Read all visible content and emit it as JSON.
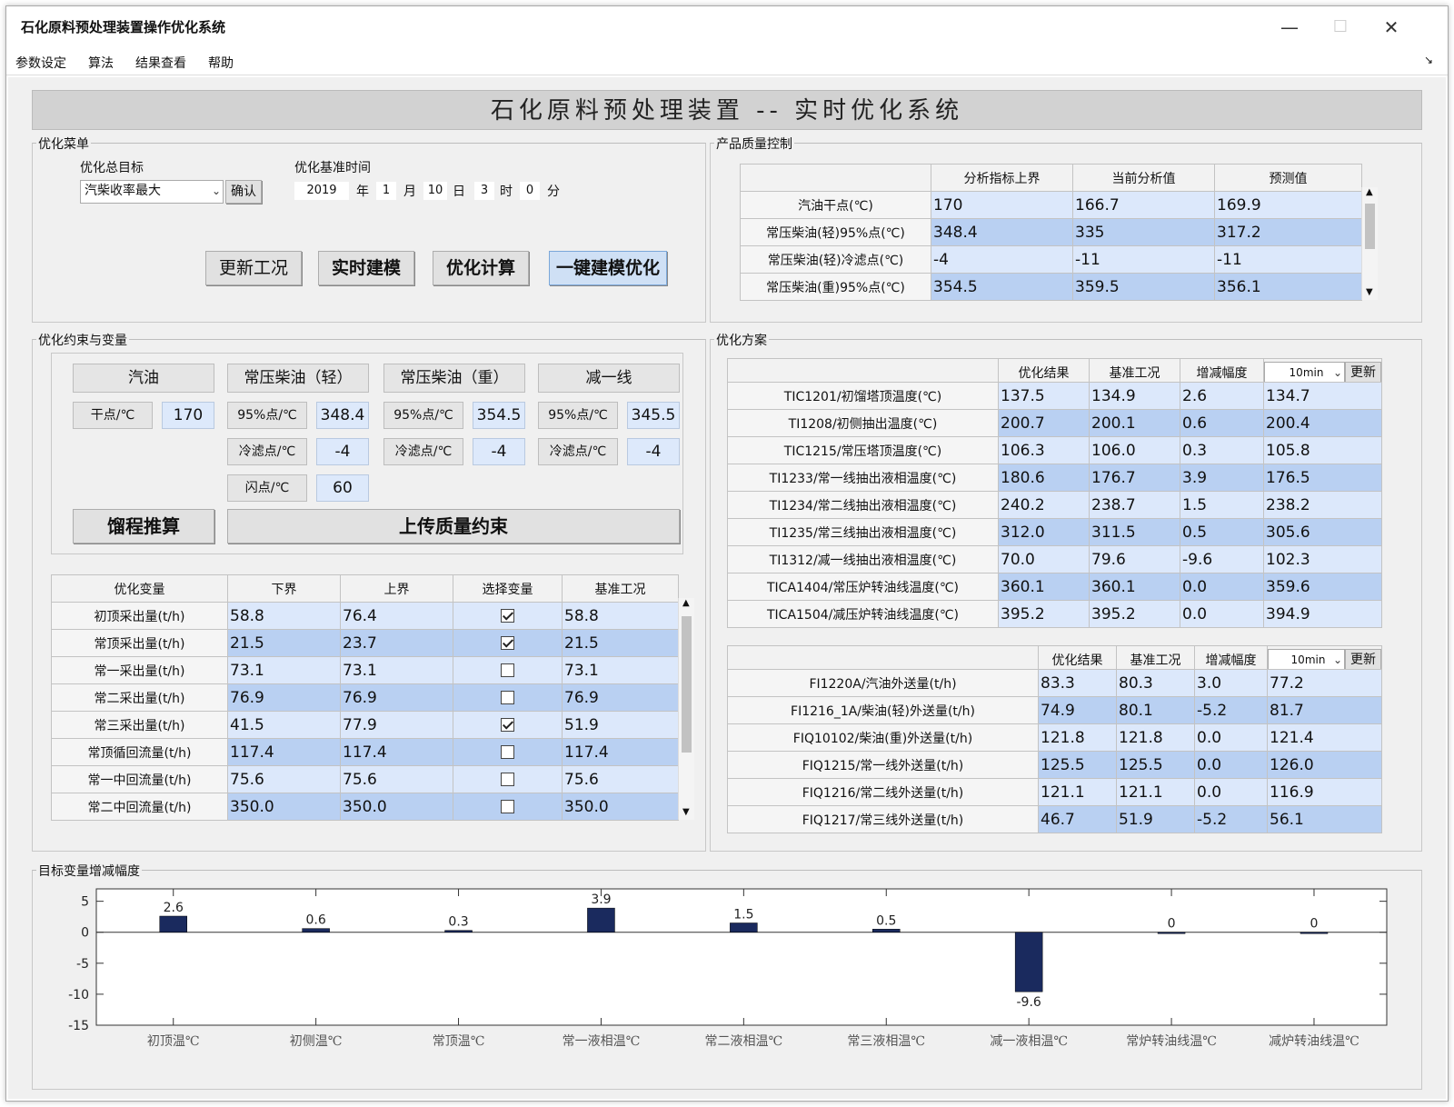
{
  "window": {
    "title": "石化原料预处理装置操作优化系统"
  },
  "menu": [
    "参数设定",
    "算法",
    "结果查看",
    "帮助"
  ],
  "banner": "石化原料预处理装置 -- 实时优化系统",
  "opt_menu": {
    "title": "优化菜单",
    "goal_label": "优化总目标",
    "goal_value": "汽柴收率最大",
    "confirm": "确认",
    "time_label": "优化基准时间",
    "year": "2019",
    "year_u": "年",
    "month": "1",
    "month_u": "月",
    "day": "10",
    "day_u": "日",
    "hour": "3",
    "hour_u": "时",
    "minute": "0",
    "minute_u": "分",
    "buttons": [
      "更新工况",
      "实时建模",
      "优化计算",
      "一键建模优化"
    ]
  },
  "quality": {
    "title": "产品质量控制",
    "headers": [
      "分析指标上界",
      "当前分析值",
      "预测值"
    ],
    "rows": [
      {
        "name": "汽油干点(℃)",
        "v": [
          "170",
          "166.7",
          "169.9"
        ]
      },
      {
        "name": "常压柴油(轻)95%点(℃)",
        "v": [
          "348.4",
          "335",
          "317.2"
        ]
      },
      {
        "name": "常压柴油(轻)冷滤点(℃)",
        "v": [
          "-4",
          "-11",
          "-11"
        ]
      },
      {
        "name": "常压柴油(重)95%点(℃)",
        "v": [
          "354.5",
          "359.5",
          "356.1"
        ]
      }
    ]
  },
  "constraints": {
    "title": "优化约束与变量",
    "groups": [
      "汽油",
      "常压柴油（轻）",
      "常压柴油（重）",
      "减一线"
    ],
    "gasoline": {
      "label": "干点/℃",
      "value": "170"
    },
    "light": {
      "l1": "95%点/℃",
      "v1": "348.4",
      "l2": "冷滤点/℃",
      "v2": "-4",
      "l3": "闪点/℃",
      "v3": "60"
    },
    "heavy": {
      "l1": "95%点/℃",
      "v1": "354.5",
      "l2": "冷滤点/℃",
      "v2": "-4"
    },
    "jian": {
      "l1": "95%点/℃",
      "v1": "345.5",
      "l2": "冷滤点/℃",
      "v2": "-4"
    },
    "btn_calc": "馏程推算",
    "btn_upload": "上传质量约束"
  },
  "vars": {
    "headers": [
      "优化变量",
      "下界",
      "上界",
      "选择变量",
      "基准工况"
    ],
    "rows": [
      {
        "name": "初顶采出量(t/h)",
        "lo": "58.8",
        "hi": "76.4",
        "sel": true,
        "base": "58.8"
      },
      {
        "name": "常顶采出量(t/h)",
        "lo": "21.5",
        "hi": "23.7",
        "sel": true,
        "base": "21.5"
      },
      {
        "name": "常一采出量(t/h)",
        "lo": "73.1",
        "hi": "73.1",
        "sel": false,
        "base": "73.1"
      },
      {
        "name": "常二采出量(t/h)",
        "lo": "76.9",
        "hi": "76.9",
        "sel": false,
        "base": "76.9"
      },
      {
        "name": "常三采出量(t/h)",
        "lo": "41.5",
        "hi": "77.9",
        "sel": true,
        "base": "51.9"
      },
      {
        "name": "常顶循回流量(t/h)",
        "lo": "117.4",
        "hi": "117.4",
        "sel": false,
        "base": "117.4"
      },
      {
        "name": "常一中回流量(t/h)",
        "lo": "75.6",
        "hi": "75.6",
        "sel": false,
        "base": "75.6"
      },
      {
        "name": "常二中回流量(t/h)",
        "lo": "350.0",
        "hi": "350.0",
        "sel": false,
        "base": "350.0"
      }
    ]
  },
  "plan": {
    "title": "优化方案",
    "headers": [
      "优化结果",
      "基准工况",
      "增减幅度"
    ],
    "interval": "10min",
    "update": "更新",
    "rows": [
      {
        "name": "TIC1201/初馏塔顶温度(℃)",
        "v": [
          "137.5",
          "134.9",
          "2.6",
          "134.7"
        ]
      },
      {
        "name": "TI1208/初侧抽出温度(℃)",
        "v": [
          "200.7",
          "200.1",
          "0.6",
          "200.4"
        ]
      },
      {
        "name": "TIC1215/常压塔顶温度(℃)",
        "v": [
          "106.3",
          "106.0",
          "0.3",
          "105.8"
        ]
      },
      {
        "name": "TI1233/常一线抽出液相温度(℃)",
        "v": [
          "180.6",
          "176.7",
          "3.9",
          "176.5"
        ]
      },
      {
        "name": "TI1234/常二线抽出液相温度(℃)",
        "v": [
          "240.2",
          "238.7",
          "1.5",
          "238.2"
        ]
      },
      {
        "name": "TI1235/常三线抽出液相温度(℃)",
        "v": [
          "312.0",
          "311.5",
          "0.5",
          "305.6"
        ]
      },
      {
        "name": "TI1312/减一线抽出液相温度(℃)",
        "v": [
          "70.0",
          "79.6",
          "-9.6",
          "102.3"
        ]
      },
      {
        "name": "TICA1404/常压炉转油线温度(℃)",
        "v": [
          "360.1",
          "360.1",
          "0.0",
          "359.6"
        ]
      },
      {
        "name": "TICA1504/减压炉转油线温度(℃)",
        "v": [
          "395.2",
          "395.2",
          "0.0",
          "394.9"
        ]
      }
    ]
  },
  "plan2": {
    "headers": [
      "优化结果",
      "基准工况",
      "增减幅度"
    ],
    "interval": "10min",
    "update": "更新",
    "rows": [
      {
        "name": "FI1220A/汽油外送量(t/h)",
        "v": [
          "83.3",
          "80.3",
          "3.0",
          "77.2"
        ]
      },
      {
        "name": "FI1216_1A/柴油(轻)外送量(t/h)",
        "v": [
          "74.9",
          "80.1",
          "-5.2",
          "81.7"
        ]
      },
      {
        "name": "FIQ10102/柴油(重)外送量(t/h)",
        "v": [
          "121.8",
          "121.8",
          "0.0",
          "121.4"
        ]
      },
      {
        "name": "FIQ1215/常一线外送量(t/h)",
        "v": [
          "125.5",
          "125.5",
          "0.0",
          "126.0"
        ]
      },
      {
        "name": "FIQ1216/常二线外送量(t/h)",
        "v": [
          "121.1",
          "121.1",
          "0.0",
          "116.9"
        ]
      },
      {
        "name": "FIQ1217/常三线外送量(t/h)",
        "v": [
          "46.7",
          "51.9",
          "-5.2",
          "56.1"
        ]
      }
    ]
  },
  "chart_section": {
    "title": "目标变量增减幅度"
  },
  "chart_data": {
    "type": "bar",
    "title": "",
    "categories": [
      "初顶温℃",
      "初侧温℃",
      "常顶温℃",
      "常一液相温℃",
      "常二液相温℃",
      "常三液相温℃",
      "减一液相温℃",
      "常炉转油线温℃",
      "减炉转油线温℃"
    ],
    "values": [
      2.6,
      0.6,
      0.3,
      3.9,
      1.5,
      0.5,
      -9.6,
      0,
      0
    ],
    "labels": [
      "2.6",
      "0.6",
      "0.3",
      "3.9",
      "1.5",
      "0.5",
      "-9.6",
      "0",
      "0"
    ],
    "ylim": [
      -15,
      7
    ],
    "yticks": [
      5,
      0,
      -5,
      -10,
      -15
    ],
    "grid": false,
    "bar_color": "#1a2a5e"
  }
}
